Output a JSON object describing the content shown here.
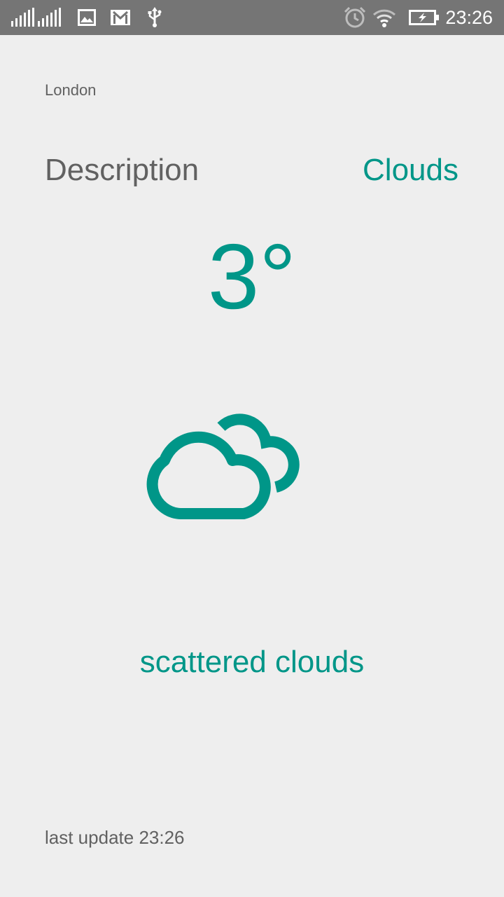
{
  "status_bar": {
    "time": "23:26",
    "icons": [
      "signal-icon",
      "signal-icon-2",
      "gallery-icon",
      "gmail-icon",
      "usb-icon",
      "alarm-icon",
      "wifi-icon",
      "battery-charging-icon"
    ]
  },
  "location": {
    "city": "London"
  },
  "description": {
    "label": "Description",
    "value": "Clouds"
  },
  "weather": {
    "temperature": "3°",
    "icon": "scattered-clouds-icon",
    "summary": "scattered clouds"
  },
  "footer": {
    "last_update_label": "last update",
    "last_update_time": "23:26"
  },
  "colors": {
    "accent": "#009688",
    "text_gray": "#616161",
    "background": "#eeeeee",
    "status_bar": "#757575"
  }
}
